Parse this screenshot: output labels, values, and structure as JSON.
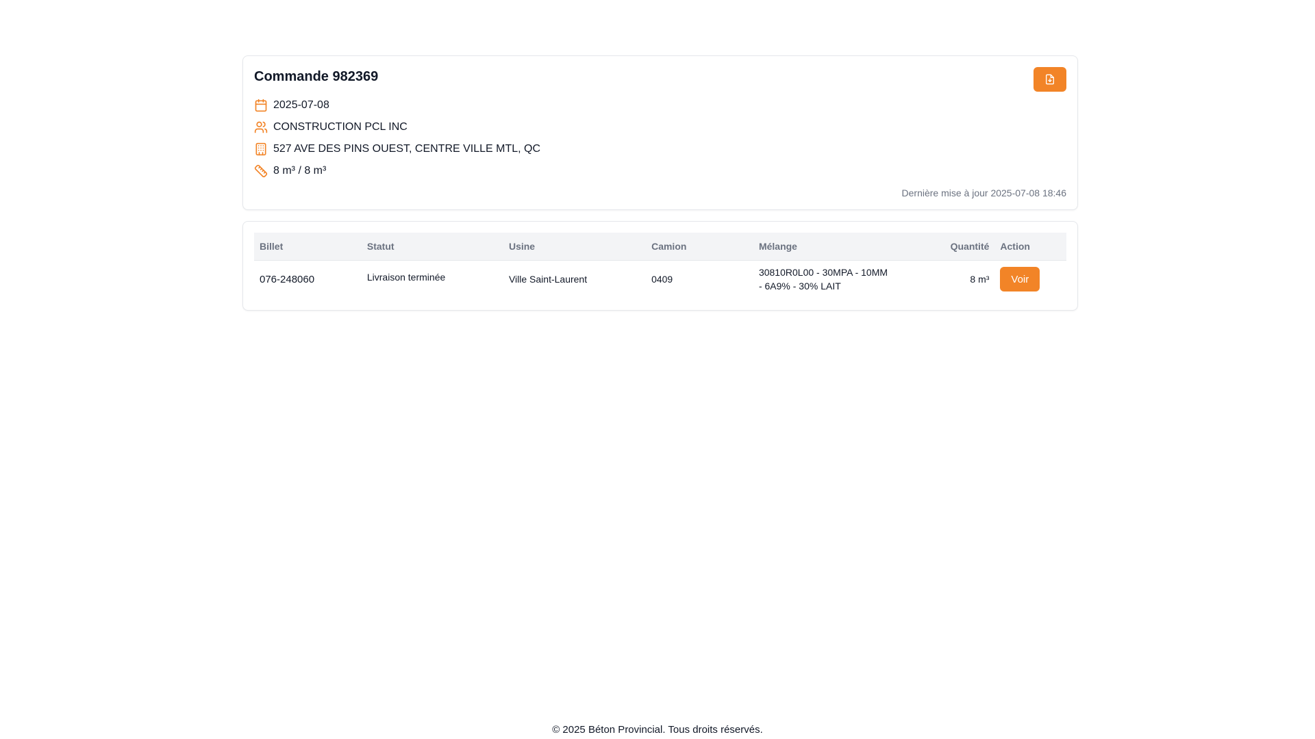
{
  "order": {
    "title": "Commande 982369",
    "date": "2025-07-08",
    "client": "CONSTRUCTION PCL INC",
    "address": "527 AVE DES PINS OUEST, CENTRE VILLE MTL, QC",
    "volume": "8 m³ / 8 m³",
    "updated": "Dernière mise à jour 2025-07-08 18:46"
  },
  "icons": {
    "accent": "#f28427",
    "date": "calendar-icon",
    "client": "users-icon",
    "address": "building-icon",
    "volume": "ruler-icon",
    "pdf": "file-download-icon"
  },
  "table": {
    "headers": {
      "billet": "Billet",
      "statut": "Statut",
      "usine": "Usine",
      "camion": "Camion",
      "melange": "Mélange",
      "quantite": "Quantité",
      "action": "Action"
    },
    "rows": [
      {
        "billet": "076-248060",
        "statut": "Livraison terminée",
        "usine": "Ville Saint-Laurent",
        "camion": "0409",
        "melange": "30810R0L00 - 30MPA - 10MM - 6A9% - 30% LAIT",
        "quantite": "8 m³",
        "action": "Voir"
      }
    ]
  },
  "footer": {
    "text": "© 2025 Béton Provincial. Tous droits réservés."
  }
}
